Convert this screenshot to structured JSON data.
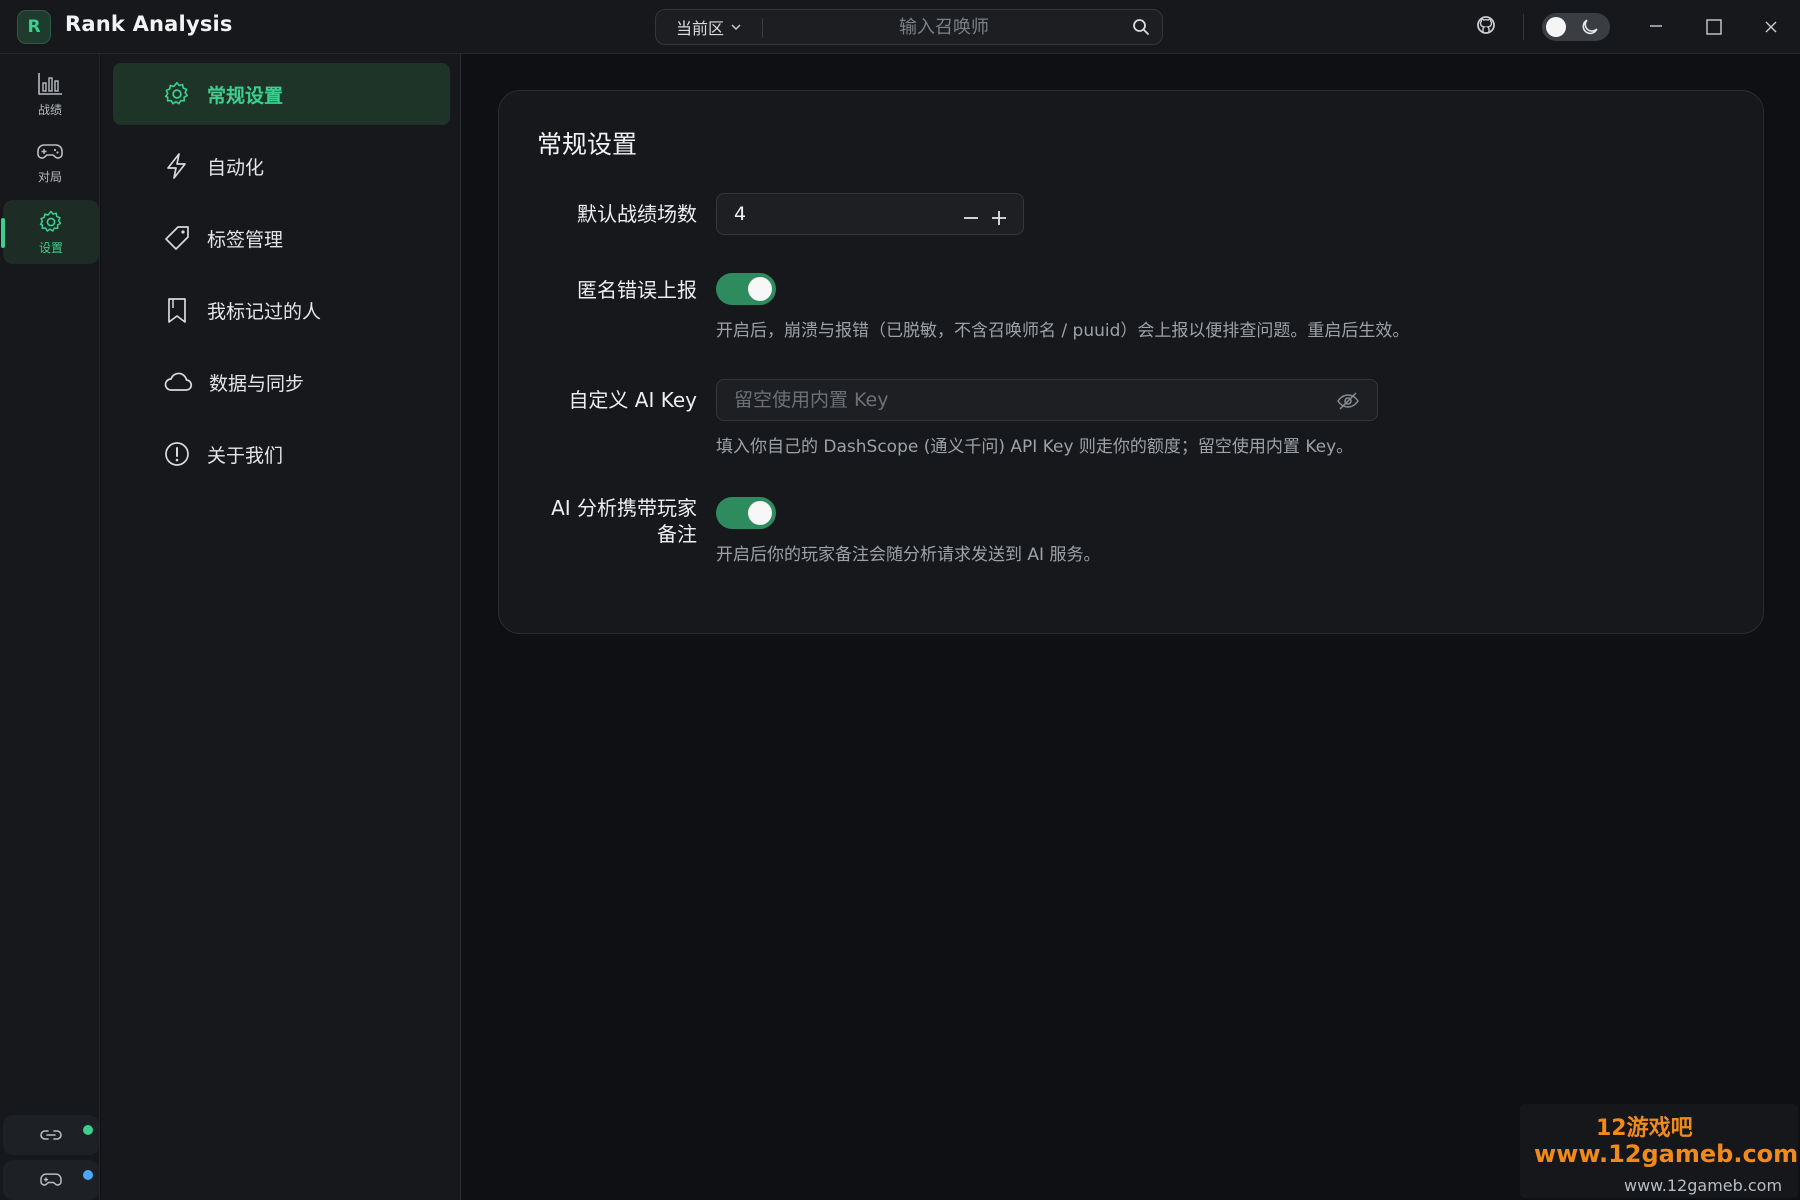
{
  "app": {
    "logo_letter": "R",
    "title": "Rank Analysis"
  },
  "topbar": {
    "region_label": "当前区",
    "search_placeholder": "输入召唤师",
    "icons": [
      "github-icon",
      "theme-toggle",
      "minimize-icon",
      "maximize-icon",
      "close-icon"
    ]
  },
  "rail": {
    "items": [
      {
        "label": "战绩",
        "icon": "bar-chart-icon"
      },
      {
        "label": "对局",
        "icon": "gamepad-icon"
      },
      {
        "label": "设置",
        "icon": "gear-icon",
        "active": true
      }
    ],
    "bottom": [
      {
        "icon": "link-icon",
        "status_color": "#3ccf8e"
      },
      {
        "icon": "gamepad-icon",
        "status_color": "#4aa8ff"
      }
    ]
  },
  "settings_nav": {
    "items": [
      {
        "label": "常规设置",
        "icon": "gear-icon",
        "active": true
      },
      {
        "label": "自动化",
        "icon": "lightning-icon"
      },
      {
        "label": "标签管理",
        "icon": "tag-icon"
      },
      {
        "label": "我标记过的人",
        "icon": "bookmark-icon"
      },
      {
        "label": "数据与同步",
        "icon": "cloud-icon"
      },
      {
        "label": "关于我们",
        "icon": "info-icon"
      }
    ]
  },
  "general": {
    "title": "常规设置",
    "default_matches": {
      "label": "默认战绩场数",
      "value": "4"
    },
    "anon_report": {
      "label": "匿名错误上报",
      "enabled": true,
      "help": "开启后，崩溃与报错（已脱敏，不含召唤师名 / puuid）会上报以便排查问题。重启后生效。"
    },
    "ai_key": {
      "label": "自定义 AI Key",
      "placeholder": "留空使用内置 Key",
      "help": "填入你自己的 DashScope (通义千问) API Key 则走你的额度；留空使用内置 Key。"
    },
    "ai_notes": {
      "label_line1": "AI 分析携带玩家",
      "label_line2": "备注",
      "enabled": true,
      "help": "开启后你的玩家备注会随分析请求发送到 AI 服务。"
    }
  },
  "watermark": {
    "line1": "12游戏吧",
    "line2": "www.12gameb.com",
    "sub": "www.12gameb.com"
  },
  "colors": {
    "accent": "#3ccf8e",
    "switch_on": "#2e8b5e",
    "background": "#0f1013",
    "panel": "#16181b"
  }
}
